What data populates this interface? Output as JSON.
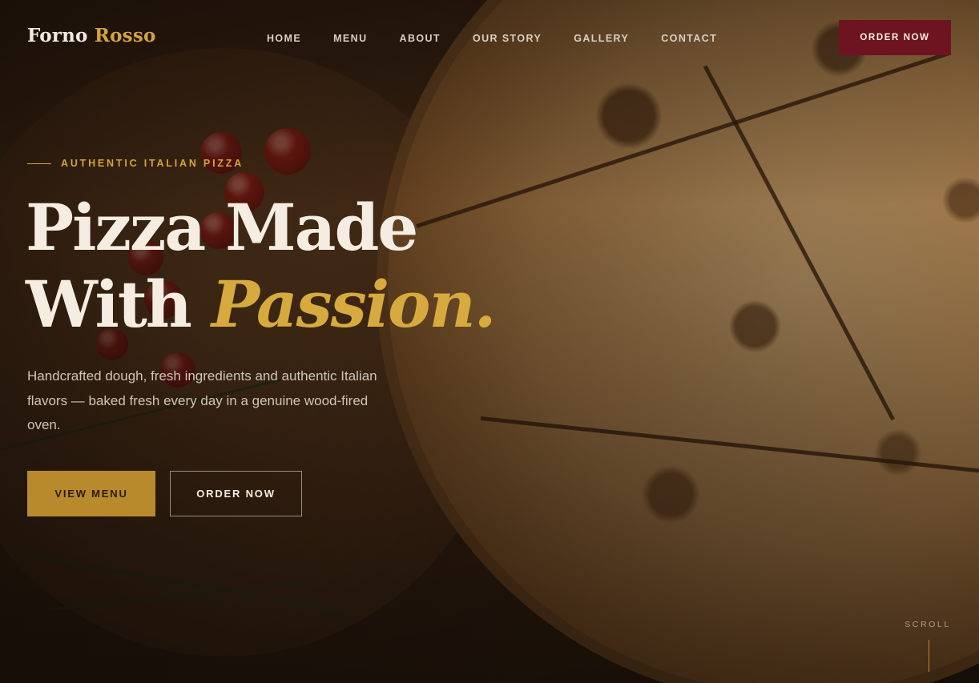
{
  "brand": {
    "name_primary": "Forno",
    "name_accent": "Rosso"
  },
  "nav": {
    "items": [
      {
        "label": "HOME"
      },
      {
        "label": "MENU"
      },
      {
        "label": "ABOUT"
      },
      {
        "label": "OUR STORY"
      },
      {
        "label": "GALLERY"
      },
      {
        "label": "CONTACT"
      }
    ],
    "cta_label": "ORDER NOW"
  },
  "hero": {
    "eyebrow": "AUTHENTIC ITALIAN PIZZA",
    "title_line1": "Pizza Made",
    "title_line2_plain": "With",
    "title_line2_accent": "Passion.",
    "description": "Handcrafted dough, fresh ingredients and authentic Italian flavors — baked fresh every day in a genuine wood-fired oven.",
    "primary_button": "VIEW MENU",
    "secondary_button": "ORDER NOW",
    "scroll_label": "SCROLL"
  },
  "colors": {
    "accent_gold": "#d4a43a",
    "brand_red": "#6e1420",
    "text_light": "#f5ede2"
  }
}
